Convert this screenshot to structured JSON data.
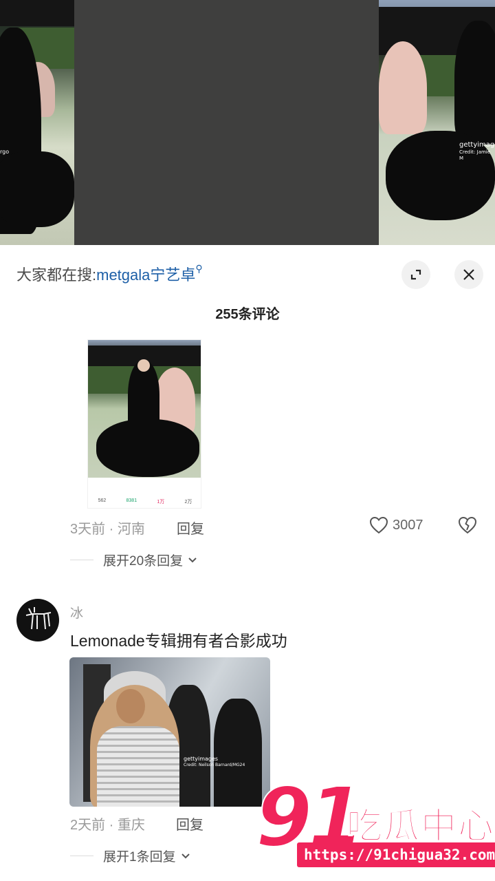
{
  "top_images": {
    "left_watermark": "rgo",
    "right_watermark_brand": "gettyimages",
    "right_watermark_credit": "Credit: Jamie M"
  },
  "sheet": {
    "search_prefix": "大家都在搜:",
    "search_query": "metgala宁艺卓",
    "comment_count": "255条评论"
  },
  "comment1": {
    "image_stats": [
      "562",
      "8381",
      "1万",
      "2万"
    ],
    "meta": "3天前 · 河南",
    "reply_label": "回复",
    "likes": "3007",
    "expand_replies": "展开20条回复"
  },
  "comment2": {
    "username": "冰",
    "text": "Lemonade专辑拥有者合影成功",
    "image_watermark_brand": "gettyimages",
    "image_watermark_credit": "Credit: Neilson Barnard/MG24",
    "meta": "2天前 · 重庆",
    "reply_label": "回复",
    "expand_replies": "展开1条回复"
  },
  "brand": {
    "number": "91",
    "name": "吃瓜中心",
    "url": "https://91chigua32.com"
  },
  "colors": {
    "brand_pink": "#f0245a",
    "search_blue": "#1d5fa7",
    "dark_frame": "#3f3f3e"
  }
}
